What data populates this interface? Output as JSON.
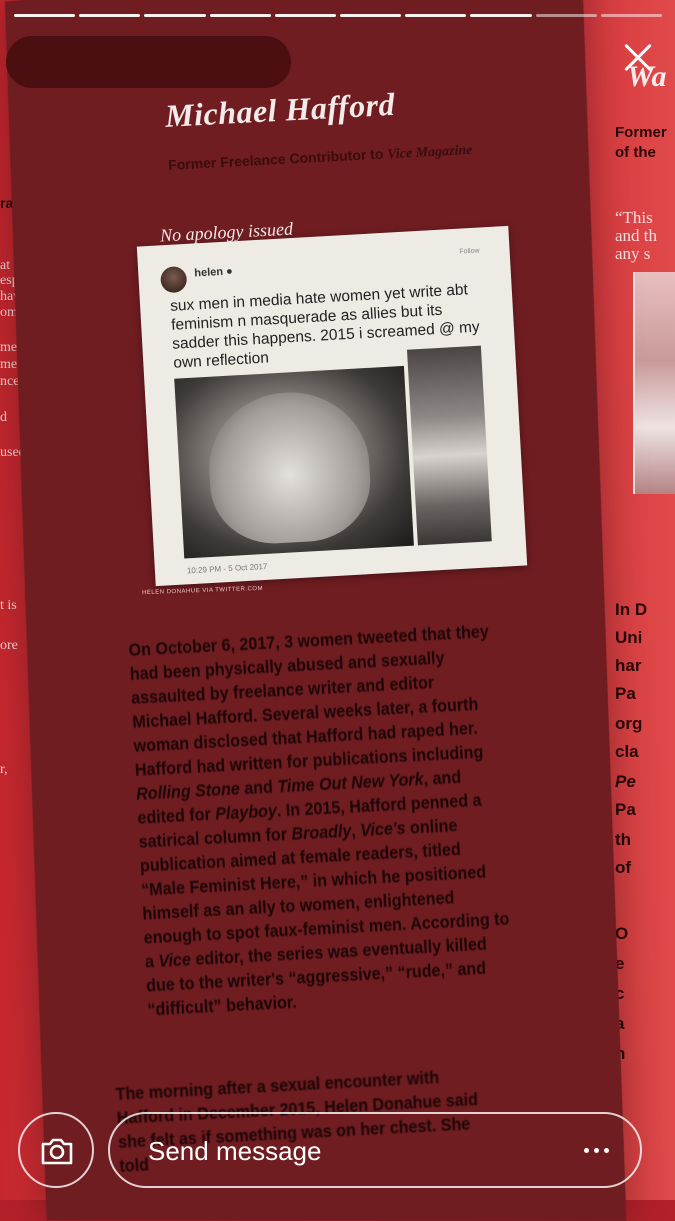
{
  "story": {
    "progress_segments": 10,
    "progress_completed": 8
  },
  "article": {
    "name": "Michael Hafford",
    "subtitle_prefix": "Former Freelance Contributor to ",
    "subtitle_pub": "Vice Magazine",
    "apology_status": "No apology issued",
    "tweet": {
      "handle": "helen",
      "follow_label": "Follow",
      "text": "sux men in media hate women yet write abt feminism n masquerade as allies but its sadder this happens. 2015 i screamed @ my own reflection",
      "timestamp": "10:29 PM - 5 Oct 2017"
    },
    "photo_credit": "HELEN DONAHUE VIA TWITTER.COM",
    "body_p1_parts": [
      "On October 6, 2017, 3 women tweeted that they had been physically abused and sexually assaulted by freelance writer and editor Michael Hafford. Several weeks later, a fourth woman disclosed that Hafford had raped her. Hafford had written for publications including ",
      "Rolling Stone",
      " and ",
      "Time Out New York",
      ", and edited for ",
      "Playboy",
      ". In 2015, Hafford penned a satirical column for ",
      "Broadly",
      ", ",
      "Vice's",
      " online publication aimed at female readers, titled “Male Feminist Here,” in which he positioned himself as an ally to women, enlightened enough to spot faux-feminist men. According to a ",
      "Vice",
      " editor, the series was eventually killed due to the writer's “aggressive,” “rude,” and “difficult” behavior."
    ],
    "body_p2": "The morning after a sexual encounter with Hafford in December 2015, Helen Donahue said she felt as if something was on her chest. She told"
  },
  "left_fragments": [
    "ration",
    "at",
    "espect",
    "have",
    "omen",
    "mes",
    "me",
    "nces.",
    "d",
    "used",
    "t is",
    "ore",
    "r,"
  ],
  "right_fragments": {
    "title": "Wa",
    "sub": [
      "Former",
      "of the"
    ],
    "quote": [
      "“This",
      "and th",
      "any s"
    ],
    "body": [
      "In D",
      "Uni",
      "har",
      "Pa",
      "org",
      "cla",
      "Pe",
      "Pa",
      "th",
      "of",
      "O",
      "e",
      "c",
      "a",
      "n"
    ]
  },
  "bottom_bar": {
    "message_placeholder": "Send message"
  }
}
